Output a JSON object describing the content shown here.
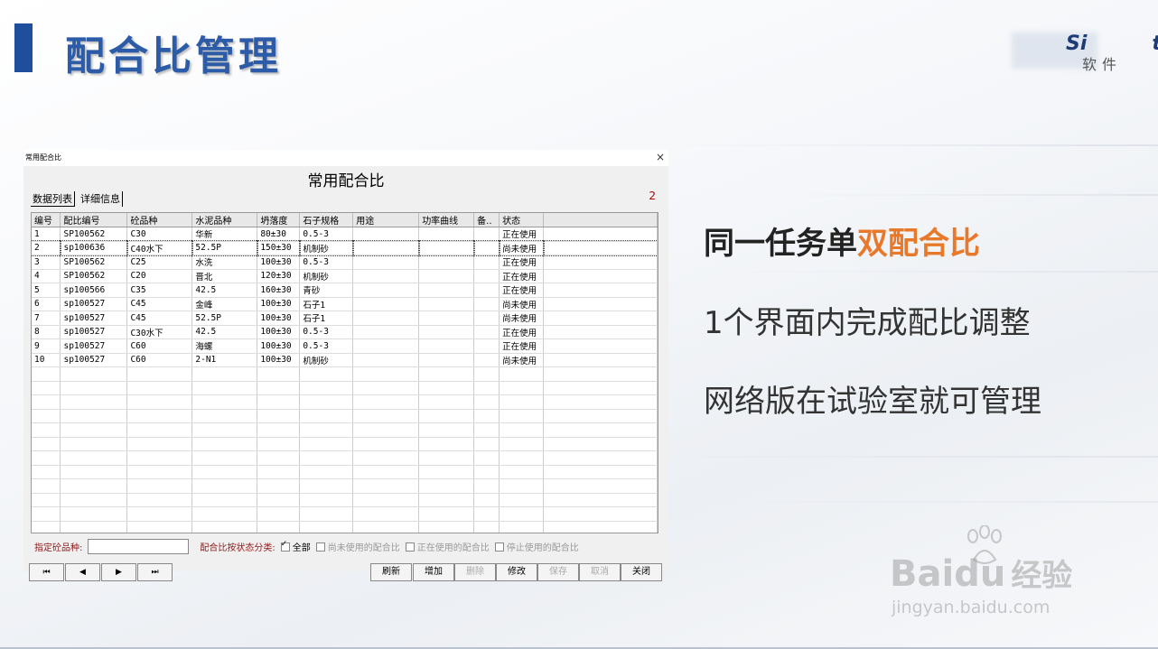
{
  "slide": {
    "title": "配合比管理",
    "logo_text": "Si",
    "logo_text_end": "t",
    "logo_sub": "软件"
  },
  "dialog": {
    "caption": "常用配合比",
    "close": "×",
    "heading": "常用配合比",
    "tabs": [
      "数据列表",
      "详细信息"
    ],
    "count": "2",
    "columns": [
      "编号",
      "配比编号",
      "砼品种",
      "水泥品种",
      "坍落度",
      "石子规格",
      "用途",
      "功率曲线",
      "备..",
      "状态"
    ],
    "rows": [
      [
        "1",
        "SP100562",
        "C30",
        "华新",
        "80±30",
        "0.5-3",
        "",
        "",
        "",
        "正在使用"
      ],
      [
        "2",
        "sp100636",
        "C40水下",
        "52.5P",
        "150±30",
        "机制砂",
        "",
        "",
        "",
        "尚未使用"
      ],
      [
        "3",
        "SP100562",
        "C25",
        "水洗",
        "100±30",
        "0.5-3",
        "",
        "",
        "",
        "正在使用"
      ],
      [
        "4",
        "SP100562",
        "C20",
        "晋北",
        "120±30",
        "机制砂",
        "",
        "",
        "",
        "正在使用"
      ],
      [
        "5",
        "sp100566",
        "C35",
        "42.5",
        "160±30",
        "青砂",
        "",
        "",
        "",
        "正在使用"
      ],
      [
        "6",
        "sp100527",
        "C45",
        "金峰",
        "100±30",
        "石子1",
        "",
        "",
        "",
        "尚未使用"
      ],
      [
        "7",
        "sp100527",
        "C45",
        "52.5P",
        "100±30",
        "石子1",
        "",
        "",
        "",
        "尚未使用"
      ],
      [
        "8",
        "sp100527",
        "C30水下",
        "42.5",
        "100±30",
        "0.5-3",
        "",
        "",
        "",
        "正在使用"
      ],
      [
        "9",
        "sp100527",
        "C60",
        "海螺",
        "100±30",
        "0.5-3",
        "",
        "",
        "",
        "正在使用"
      ],
      [
        "10",
        "sp100527",
        "C60",
        "2-N1",
        "100±30",
        "机制砂",
        "",
        "",
        "",
        "尚未使用"
      ]
    ],
    "filter": {
      "label_grade": "指定砼品种:",
      "grade_value": "",
      "label_status": "配合比按状态分类:",
      "opt_all": "全部",
      "opt_unused": "尚未使用的配合比",
      "opt_in_use": "正在使用的配合比",
      "opt_stopped": "停止使用的配合比"
    },
    "nav": [
      "⏮",
      "◀",
      "▶",
      "⏭"
    ],
    "actions": {
      "refresh": "刷新",
      "add": "增加",
      "delete": "删除",
      "edit": "修改",
      "save": "保存",
      "cancel": "取消",
      "close": "关闭"
    }
  },
  "bullets": {
    "b1_main": "同一任务单",
    "b1_highlight": "双配合比",
    "b2": "1个界面内完成配比调整",
    "b3": "网络版在试验室就可管理"
  },
  "watermark": {
    "brand": "Bai",
    "brand_du": "du",
    "brand_cn": "经验",
    "url": "jingyan.baidu.com"
  },
  "colors": {
    "title_blue": "#2c5ca8",
    "accent_orange": "#e8782a",
    "label_red": "#8b1a1a"
  }
}
